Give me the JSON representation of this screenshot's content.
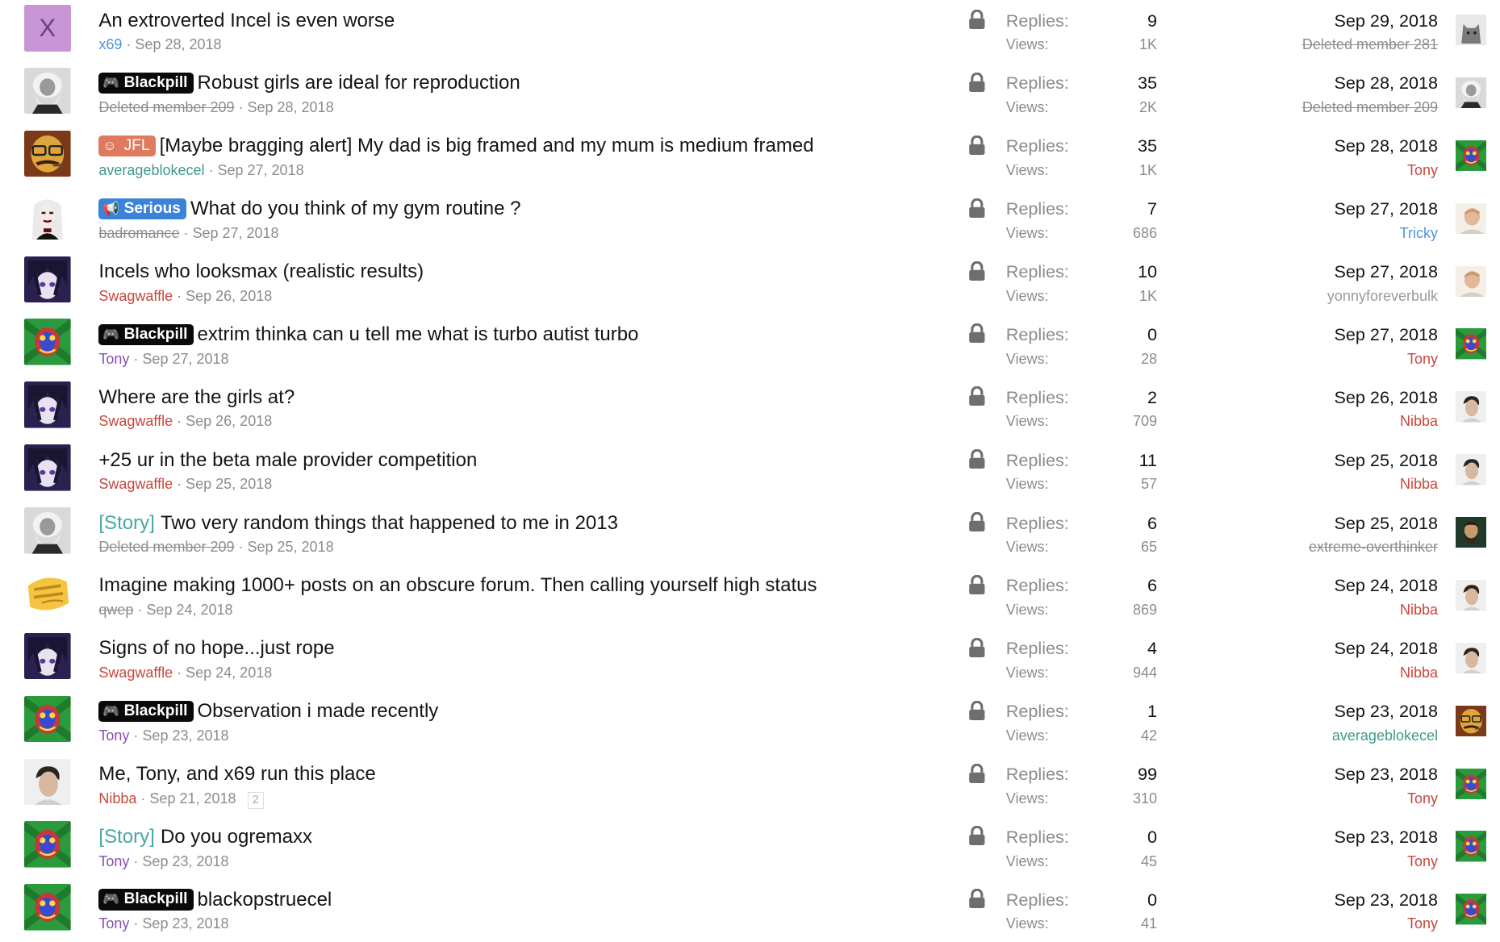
{
  "labels": {
    "replies": "Replies:",
    "views": "Views:"
  },
  "threads": [
    {
      "avatar": "letter",
      "avatar_letter": "X",
      "prefix": "",
      "story": false,
      "title": "An extroverted Incel is even worse",
      "author": "x69",
      "author_style": "teal-blue",
      "date": "Sep 28, 2018",
      "pages": "",
      "replies": "9",
      "views": "1K",
      "last_date": "Sep 29, 2018",
      "last_user": "Deleted member 281",
      "last_user_style": "deleted",
      "last_avatar": "cat"
    },
    {
      "avatar": "marx",
      "prefix": "Blackpill",
      "story": false,
      "title": "Robust girls are ideal for reproduction",
      "author": "Deleted member 209",
      "author_style": "deleted",
      "date": "Sep 28, 2018",
      "pages": "",
      "replies": "35",
      "views": "2K",
      "last_date": "Sep 28, 2018",
      "last_user": "Deleted member 209",
      "last_user_style": "deleted",
      "last_avatar": "marx"
    },
    {
      "avatar": "glasses",
      "prefix": "JFL",
      "story": false,
      "title": "[Maybe bragging alert] My dad is big framed and my mum is medium framed",
      "author": "averageblokecel",
      "author_style": "teal",
      "date": "Sep 27, 2018",
      "pages": "",
      "replies": "35",
      "views": "1K",
      "last_date": "Sep 28, 2018",
      "last_user": "Tony",
      "last_user_style": "red",
      "last_avatar": "psy"
    },
    {
      "avatar": "gothic",
      "prefix": "Serious",
      "story": false,
      "title": "What do you think of my gym routine ?",
      "author": "badromance",
      "author_style": "deleted",
      "date": "Sep 27, 2018",
      "pages": "",
      "replies": "7",
      "views": "686",
      "last_date": "Sep 27, 2018",
      "last_user": "Tricky",
      "last_user_style": "blue",
      "last_avatar": "face-light"
    },
    {
      "avatar": "anime",
      "prefix": "",
      "story": false,
      "title": "Incels who looksmax (realistic results)",
      "author": "Swagwaffle",
      "author_style": "red",
      "date": "Sep 26, 2018",
      "pages": "",
      "replies": "10",
      "views": "1K",
      "last_date": "Sep 27, 2018",
      "last_user": "yonnyforeverbulk",
      "last_user_style": "grey",
      "last_avatar": "face-light"
    },
    {
      "avatar": "psy",
      "prefix": "Blackpill",
      "story": false,
      "title": "extrim thinka can u tell me what is turbo autist turbo",
      "author": "Tony",
      "author_style": "purple",
      "date": "Sep 27, 2018",
      "pages": "",
      "replies": "0",
      "views": "28",
      "last_date": "Sep 27, 2018",
      "last_user": "Tony",
      "last_user_style": "red",
      "last_avatar": "psy"
    },
    {
      "avatar": "anime",
      "prefix": "",
      "story": false,
      "title": "Where are the girls at?",
      "author": "Swagwaffle",
      "author_style": "red",
      "date": "Sep 26, 2018",
      "pages": "",
      "replies": "2",
      "views": "709",
      "last_date": "Sep 26, 2018",
      "last_user": "Nibba",
      "last_user_style": "red",
      "last_avatar": "man"
    },
    {
      "avatar": "anime",
      "prefix": "",
      "story": false,
      "title": "+25 ur in the beta male provider competition",
      "author": "Swagwaffle",
      "author_style": "red",
      "date": "Sep 25, 2018",
      "pages": "",
      "replies": "11",
      "views": "57",
      "last_date": "Sep 25, 2018",
      "last_user": "Nibba",
      "last_user_style": "red",
      "last_avatar": "man"
    },
    {
      "avatar": "marx",
      "prefix": "",
      "story": true,
      "story_label": "[Story]",
      "title": "Two very random things that happened to me in 2013",
      "author": "Deleted member 209",
      "author_style": "deleted",
      "date": "Sep 25, 2018",
      "pages": "",
      "replies": "6",
      "views": "65",
      "last_date": "Sep 25, 2018",
      "last_user": "extreme-overthinker",
      "last_user_style": "deleted",
      "last_avatar": "bearded"
    },
    {
      "avatar": "emoji",
      "prefix": "",
      "story": false,
      "title": "Imagine making 1000+ posts on an obscure forum. Then calling yourself high status",
      "author": "qwep",
      "author_style": "deleted",
      "date": "Sep 24, 2018",
      "pages": "",
      "replies": "6",
      "views": "869",
      "last_date": "Sep 24, 2018",
      "last_user": "Nibba",
      "last_user_style": "red",
      "last_avatar": "man"
    },
    {
      "avatar": "anime",
      "prefix": "",
      "story": false,
      "title": "Signs of no hope...just rope",
      "author": "Swagwaffle",
      "author_style": "red",
      "date": "Sep 24, 2018",
      "pages": "",
      "replies": "4",
      "views": "944",
      "last_date": "Sep 24, 2018",
      "last_user": "Nibba",
      "last_user_style": "red",
      "last_avatar": "man"
    },
    {
      "avatar": "psy",
      "prefix": "Blackpill",
      "story": false,
      "title": "Observation i made recently",
      "author": "Tony",
      "author_style": "purple",
      "date": "Sep 23, 2018",
      "pages": "",
      "replies": "1",
      "views": "42",
      "last_date": "Sep 23, 2018",
      "last_user": "averageblokecel",
      "last_user_style": "teal",
      "last_avatar": "glasses"
    },
    {
      "avatar": "man",
      "prefix": "",
      "story": false,
      "title": "Me, Tony, and x69 run this place",
      "author": "Nibba",
      "author_style": "red",
      "date": "Sep 21, 2018",
      "pages": "2",
      "replies": "99",
      "views": "310",
      "last_date": "Sep 23, 2018",
      "last_user": "Tony",
      "last_user_style": "red",
      "last_avatar": "psy"
    },
    {
      "avatar": "psy",
      "prefix": "",
      "story": true,
      "story_label": "[Story]",
      "title": "Do you ogremaxx",
      "author": "Tony",
      "author_style": "purple",
      "date": "Sep 23, 2018",
      "pages": "",
      "replies": "0",
      "views": "45",
      "last_date": "Sep 23, 2018",
      "last_user": "Tony",
      "last_user_style": "red",
      "last_avatar": "psy"
    },
    {
      "avatar": "psy",
      "prefix": "Blackpill",
      "story": false,
      "title": "blackopstruecel",
      "author": "Tony",
      "author_style": "purple",
      "date": "Sep 23, 2018",
      "pages": "",
      "replies": "0",
      "views": "41",
      "last_date": "Sep 23, 2018",
      "last_user": "Tony",
      "last_user_style": "red",
      "last_avatar": "psy"
    }
  ],
  "colors": {
    "blackpill": "#0a0a0a",
    "jfl": "#e07a5f",
    "serious": "#3b82d9",
    "story": "#47a7a3",
    "red_user": "#c9463d",
    "purple_user": "#8a4fb0",
    "teal_user": "#3f9a8a"
  }
}
